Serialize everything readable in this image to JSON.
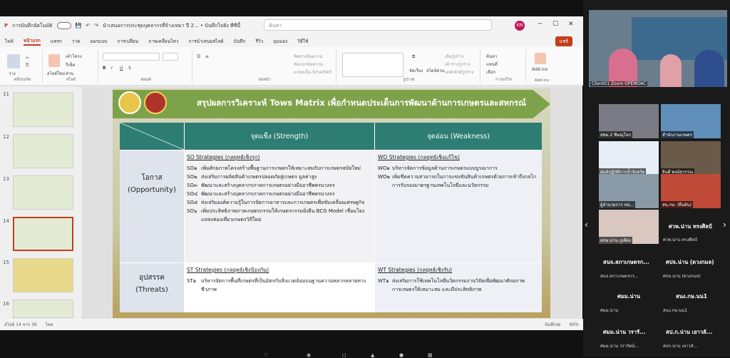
{
  "titlebar": {
    "autosave": "การบันทึกอัตโนมัติ",
    "filename": "นำเสนอการประชุมบุคลากรที่จ้างเหมา ปี 2... • บันทึกไปยัง พีซีนี้",
    "search_placeholder": "ค้นหา",
    "avatar": "KN"
  },
  "menu": {
    "items": [
      "ไฟล์",
      "หน้าแรก",
      "แทรก",
      "วาด",
      "ออกแบบ",
      "การเปลี่ยน",
      "ภาพเคลื่อนไหว",
      "การนำเสนอสไลด์",
      "บันทึก",
      "รีวิว",
      "มุมมอง",
      "วิธีใช้"
    ],
    "share": "แชร์"
  },
  "ribbon": {
    "groups": [
      "คลิปบอร์ด",
      "สไลด์",
      "ฟอนต์",
      "ย่อหน้า",
      "รูปวาด",
      "การแก้ไข",
      "Add-ins"
    ],
    "paste": "วาง",
    "new_slide": "สไลด์ใหม่",
    "layout": "เค้าโครง",
    "reset": "รีเซ็ต",
    "section": "ส่วน",
    "arrange": "จัดเรียง",
    "quick_styles": "สไตล์ด่วน",
    "find": "ค้นหา",
    "replace": "แทนที่",
    "select": "เลือก",
    "addins": "Add-ins",
    "shape_fill": "เติมรูปร่าง",
    "shape_outline": "เค้าร่างรูปร่าง",
    "shape_effects": "เอฟเฟกต์รูปร่าง",
    "text_direction": "ทิศทางข้อความ",
    "align_text": "จัดแนวข้อความ",
    "smartart": "แปลงเป็น SmartArt"
  },
  "thumbnails": [
    {
      "num": "11"
    },
    {
      "num": "12"
    },
    {
      "num": "13"
    },
    {
      "num": "14",
      "selected": true
    },
    {
      "num": "15"
    },
    {
      "num": "16"
    }
  ],
  "slide": {
    "title": "สรุปผลการวิเคราะห์ Tows Matrix เพื่อกำหนดประเด็นการพัฒนาด้านการเกษตรและสหกรณ์",
    "strength_header": "จุดแข็ง (Strength)",
    "weakness_header": "จุดอ่อน (Weakness)",
    "opportunity_label": "โอกาส",
    "opportunity_en": "(Opportunity)",
    "threat_label": "อุปสรรค",
    "threat_en": "(Threats)",
    "so_title": "SO Strategies (กลยุทธ์เชิงรุก)",
    "so_items": [
      {
        "code": "SO๑",
        "text": "เพิ่มศักยภาพโครงสร้างพื้นฐานการเกษตรให้เหมาะสมกับการเกษตรสมัยใหม่"
      },
      {
        "code": "SO๒",
        "text": "ส่งเสริมการผลิตสินค้าเกษตรปลอดภัยสู่เกษตร มูลค่าสูง"
      },
      {
        "code": "SO๓",
        "text": "พัฒนาและสร้างบุคลากรภาคการเกษตรอย่างมืออาชีพครบวงจร"
      },
      {
        "code": "SO๔",
        "text": "พัฒนาและสร้างบุคลากรภาคการเกษตรอย่างมืออาชีพครบวงจร"
      },
      {
        "code": "SO๕",
        "text": "ส่งเสริมองค์ความรู้ในการจัดการอาหารและการเกษตรเพื่อขับเคลื่อนเศรษฐกิจ"
      },
      {
        "code": "SO๖",
        "text": "เพิ่มประสิทธิภาพภาคเกษตรกรรมให้เกษตรกรรมยั่งยืน BCG Model เชื่อมโยงแหล่งท่องเที่ยวเกษตรวิถีใหม่"
      }
    ],
    "wo_title": "WO Strategies (กลยุทธ์เชิงแก้ไข)",
    "wo_items": [
      {
        "code": "WO๑",
        "text": "บริหารจัดการข้อมูลด้านการเกษตรแบบบูรณาการ"
      },
      {
        "code": "WO๒",
        "text": "เพิ่มขีดความสามารถในการแข่งขันสินค้าเกษตรด้วยการเข้าถึงกลไกการรับรองมาตรฐานเทคโนโลยีและนวัตกรรม"
      }
    ],
    "st_title": "ST Strategies (กลยุทธ์เชิงป้องกัน)",
    "st_items": [
      {
        "code": "ST๑",
        "text": "บริหารจัดการพื้นที่เกษตรที่เป็นมิตรกับสิ่งแวดล้อมบนฐานความหลากหลายทางชีวภาพ"
      }
    ],
    "wt_title": "WT Strategies (กลยุทธ์เชิงรับ)",
    "wt_items": [
      {
        "code": "WT๑",
        "text": "ส่งเสริมการใช้เทคโนโลยีนวัตกรรมงานวิจัยเพื่อพัฒนาศักยภาพการเกษตรให้เหมาะสม และมีประสิทธิภาพ"
      }
    ]
  },
  "statusbar": {
    "slide_count": "สไลด์ 14 จาก 36",
    "language": "ไทย",
    "notes": "บันทึกย่อ",
    "zoom": "90%"
  },
  "zoom": {
    "main_label": "Client01 Zoom OPEMOAC",
    "tiles": [
      "สพม.2 พิษณุโลก",
      "สำนักงานเกษตร",
      "ศูนย์ปฏิบัติการน้ำจังหวัด",
      "ยินดี พงษ์สุวรรณ",
      "ผู้อำนวยการ หน่...",
      "สน.กษ. (ยืนยัน)",
      "สกษ.น่าน ภูเพียง",
      ""
    ],
    "names": [
      {
        "big": "ศวพ.น่าน ทรงศิลป์",
        "small": "ศวพ.น่าน ทรงศิลป์"
      },
      {
        "big": "สนจ.สภาเกษตรก...",
        "small": "สนจ.สภาเกษตรกร..."
      },
      {
        "big": "ศปจ.น่าน (ดวงกมล)",
        "small": "ศปจ.น่าน (ดวงกมล)"
      },
      {
        "big": "ศมม.น่าน",
        "small": "ศมม.น่าน"
      },
      {
        "big": "สนง.กษ.นน1",
        "small": "สนง.กษ.นน1"
      },
      {
        "big": "ศมม.น่าน วรารั...",
        "small": "ศมม.น่าน วรารัตน์..."
      },
      {
        "big": "สป.ก.น่าน เยาวลั...",
        "small": "สปก.น่าน เยาวลั..."
      }
    ]
  },
  "colors": {
    "accent": "#c43e1c",
    "header_teal": "#2e7d73",
    "banner_green": "#7ea24a"
  }
}
